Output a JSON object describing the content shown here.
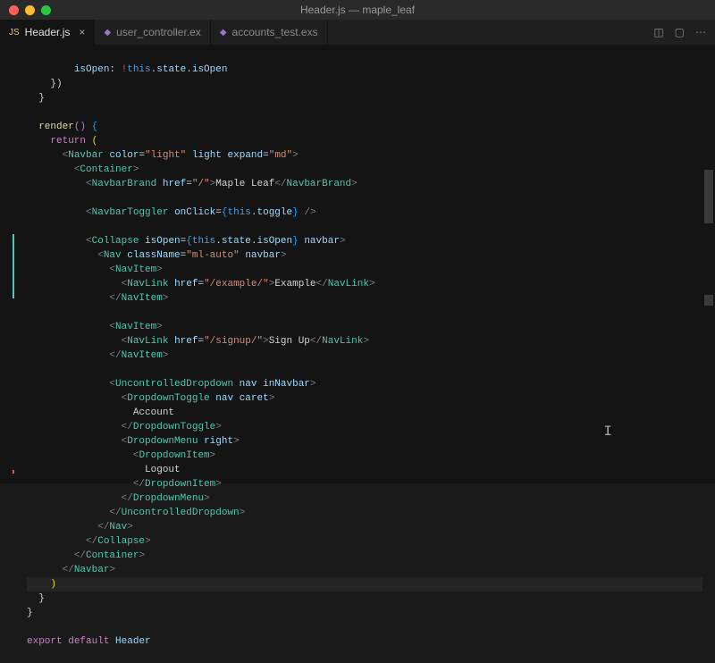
{
  "window": {
    "title": "Header.js — maple_leaf"
  },
  "tabs": {
    "t0": {
      "label": "Header.js",
      "icon_color": "#e2c08d",
      "icon_text": "JS"
    },
    "t1": {
      "label": "user_controller.ex",
      "icon_color": "#a074c4",
      "icon_text": "◆"
    },
    "t2": {
      "label": "accounts_test.exs",
      "icon_color": "#a074c4",
      "icon_text": "◆"
    }
  },
  "code": {
    "l1a": "isOpen",
    "l1b": "!",
    "l1c": "this",
    "l1d": ".state.isOpen",
    "l4a": "render",
    "l4b": "()",
    "l5a": "return",
    "l6a": "Navbar",
    "l6b": "color",
    "l6c": "\"light\"",
    "l6d": "light",
    "l6e": "expand",
    "l6f": "\"md\"",
    "l7a": "Container",
    "l8a": "NavbarBrand",
    "l8b": "href",
    "l8c": "\"/\"",
    "l8d": "Maple Leaf",
    "l10a": "NavbarToggler",
    "l10b": "onClick",
    "l10c": "this",
    "l10d": ".toggle",
    "l12a": "Collapse",
    "l12b": "isOpen",
    "l12c": "this",
    "l12d": ".state.isOpen",
    "l12e": "navbar",
    "l13a": "Nav",
    "l13b": "className",
    "l13c": "\"ml-auto\"",
    "l13d": "navbar",
    "l14a": "NavItem",
    "l15a": "NavLink",
    "l15b": "href",
    "l15c": "\"/example/\"",
    "l15d": "Example",
    "l16a": "NavItem",
    "l18a": "NavItem",
    "l19a": "NavLink",
    "l19b": "href",
    "l19c": "\"/signup/\"",
    "l19d": "Sign Up",
    "l20a": "NavItem",
    "l22a": "UncontrolledDropdown",
    "l22b": "nav",
    "l22c": "inNavbar",
    "l23a": "DropdownToggle",
    "l23b": "nav",
    "l23c": "caret",
    "l24a": "Account",
    "l25a": "DropdownToggle",
    "l26a": "DropdownMenu",
    "l26b": "right",
    "l27a": "DropdownItem",
    "l28a": "Logout",
    "l29a": "DropdownItem",
    "l30a": "DropdownMenu",
    "l31a": "UncontrolledDropdown",
    "l32a": "Nav",
    "l33a": "Collapse",
    "l34a": "Container",
    "l35a": "Navbar",
    "l36a": ")",
    "l39a": "export",
    "l39b": "default",
    "l39c": "Header"
  }
}
